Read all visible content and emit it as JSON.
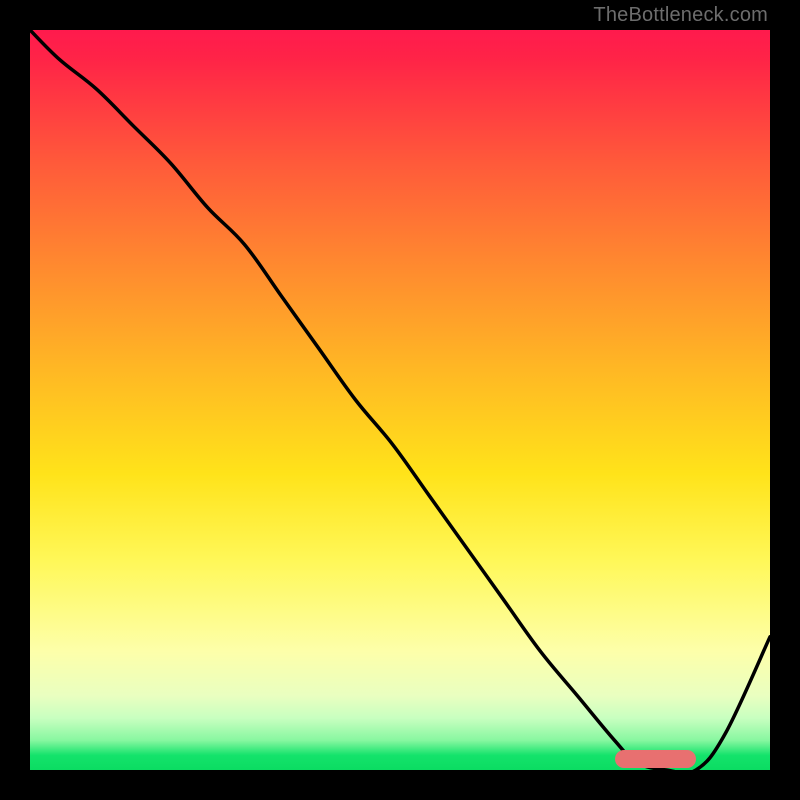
{
  "watermark": "TheBottleneck.com",
  "chart_data": {
    "type": "line",
    "title": "",
    "xlabel": "",
    "ylabel": "",
    "xlim": [
      0,
      100
    ],
    "ylim": [
      0,
      100
    ],
    "grid": false,
    "background_gradient": {
      "top_color": "#ff1a4d",
      "mid_colors": [
        "#ff8a2f",
        "#ffe31a",
        "#fdffaa"
      ],
      "bottom_color": "#0bdc62"
    },
    "series": [
      {
        "name": "bottleneck-curve",
        "color": "#000000",
        "x": [
          0,
          4,
          9,
          14,
          19,
          24,
          29,
          34,
          39,
          44,
          49,
          54,
          59,
          64,
          69,
          74,
          79,
          82,
          86,
          90,
          94,
          100
        ],
        "y": [
          100,
          96,
          92,
          87,
          82,
          76,
          71,
          64,
          57,
          50,
          44,
          37,
          30,
          23,
          16,
          10,
          4,
          1,
          0,
          0,
          5,
          18
        ]
      }
    ],
    "annotations": [
      {
        "type": "marker-bar",
        "name": "optimal-range",
        "x_start": 79,
        "x_end": 90,
        "y": 1.5,
        "color": "#e87070"
      }
    ]
  }
}
